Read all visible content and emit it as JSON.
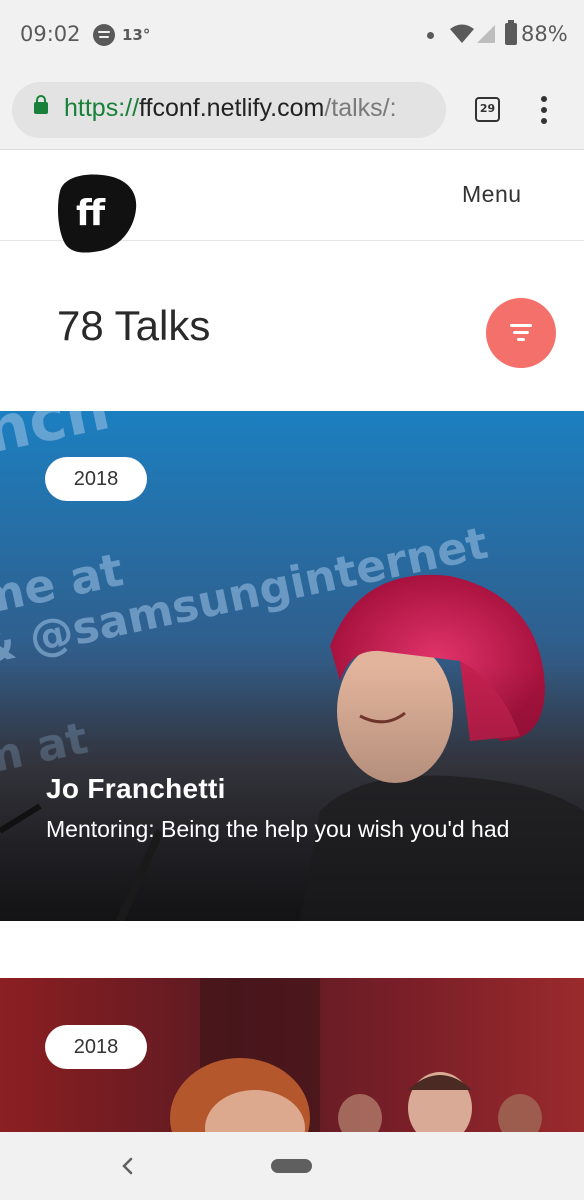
{
  "status_bar": {
    "time": "09:02",
    "temperature": "13°",
    "battery_percent": "88%",
    "icons": [
      "spotify-icon",
      "notification-dot",
      "wifi-icon",
      "signal-icon",
      "battery-icon"
    ]
  },
  "browser": {
    "url_scheme": "https://",
    "url_host": "ffconf.netlify.com",
    "url_path": "/talks/:",
    "tab_count": "29",
    "secure_color": "#188038"
  },
  "site": {
    "logo_text": "ff",
    "menu_label": "Menu"
  },
  "talks": {
    "heading": "78 Talks",
    "filter_color": "#f4706a",
    "cards": [
      {
        "year": "2018",
        "speaker": "Jo Franchetti",
        "title": "Mentoring: Being the help you wish you'd had"
      },
      {
        "year": "2018"
      }
    ]
  }
}
